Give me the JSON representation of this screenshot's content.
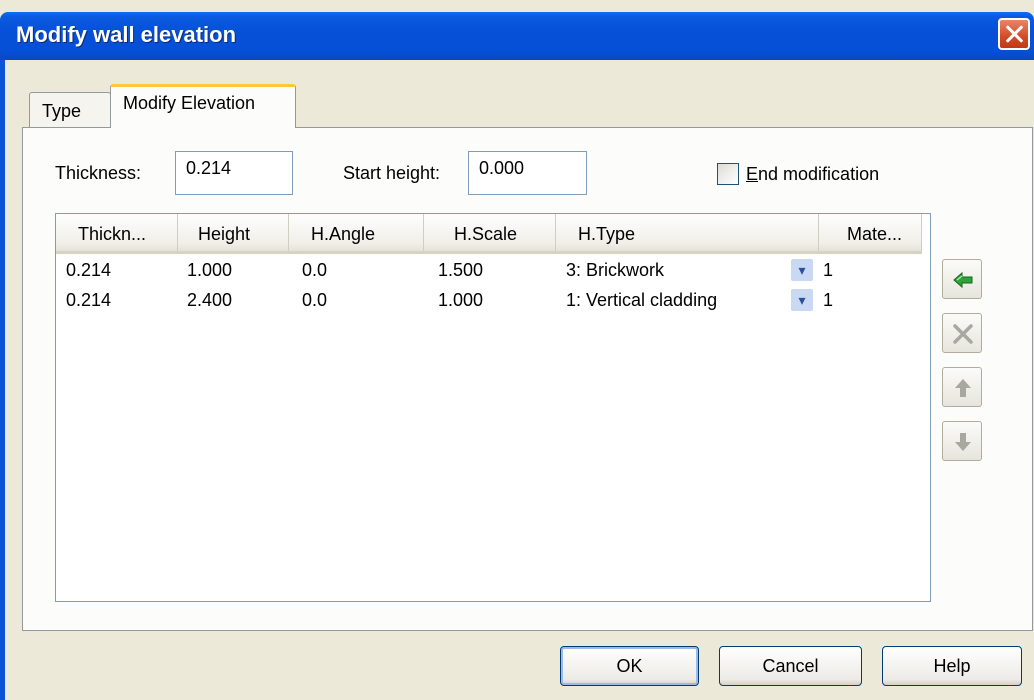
{
  "window": {
    "title": "Modify wall elevation"
  },
  "tabs": [
    {
      "label": "Type",
      "active": false
    },
    {
      "label": "Modify Elevation",
      "active": true
    }
  ],
  "form": {
    "thickness_label": "Thickness:",
    "thickness_value": "0.214",
    "start_height_label": "Start height:",
    "start_height_value": "0.000",
    "end_modification_label_first": "E",
    "end_modification_label_rest": "nd modification",
    "end_modification_checked": false
  },
  "table": {
    "columns": [
      "Thickn...",
      "Height",
      "H.Angle",
      "H.Scale",
      "H.Type",
      "Mate..."
    ],
    "rows": [
      [
        "0.214",
        "1.000",
        "0.0",
        "1.500",
        "3: Brickwork",
        "1"
      ],
      [
        "0.214",
        "2.400",
        "0.0",
        "1.000",
        "1: Vertical cladding",
        "1"
      ]
    ]
  },
  "side_buttons": [
    "add-arrow-icon",
    "delete-x-icon",
    "move-up-icon",
    "move-down-icon"
  ],
  "buttons": {
    "ok": "OK",
    "cancel": "Cancel",
    "help": "Help"
  },
  "colors": {
    "titlebar": "#0550d6",
    "accent_tab": "#ffc83c",
    "add_arrow": "#2ea33a"
  }
}
